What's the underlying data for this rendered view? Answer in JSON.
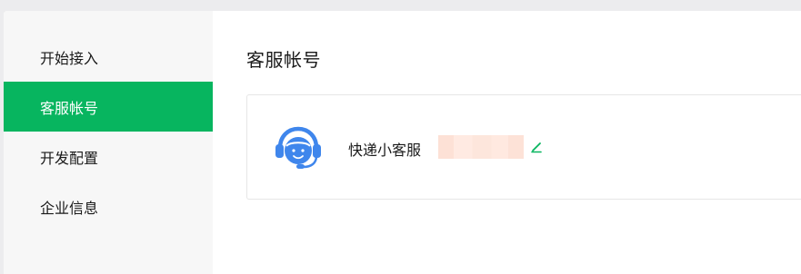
{
  "sidebar": {
    "items": [
      {
        "label": "开始接入"
      },
      {
        "label": "客服帐号"
      },
      {
        "label": "开发配置"
      },
      {
        "label": "企业信息"
      }
    ],
    "active_index": 1
  },
  "main": {
    "title": "客服帐号",
    "account": {
      "name": "快递小客服",
      "avatar_icon": "customer-service-headset-icon",
      "edit_icon": "pencil-edit-icon"
    }
  },
  "colors": {
    "accent": "#07b55f",
    "avatar_blue": "#3f86ec",
    "sidebar_bg": "#f7f7f7"
  }
}
